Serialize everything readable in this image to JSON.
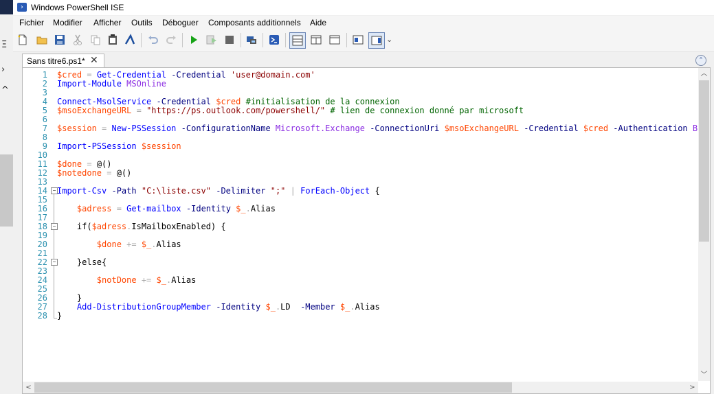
{
  "window": {
    "title": "Windows PowerShell ISE"
  },
  "menu": [
    "Fichier",
    "Modifier",
    "Afficher",
    "Outils",
    "Déboguer",
    "Composants additionnels",
    "Aide"
  ],
  "toolbar": {
    "icons": [
      "new-script-icon",
      "open-icon",
      "save-icon",
      "cut-icon",
      "copy-icon",
      "paste-icon",
      "console-prompt-icon",
      "undo-icon",
      "redo-icon",
      "run-icon",
      "run-selection-icon",
      "stop-icon",
      "remote-powershell-icon",
      "start-powershell-icon",
      "show-script-pane-top-icon",
      "show-script-pane-right-icon",
      "show-script-pane-max-icon",
      "show-command-window-icon",
      "show-command-addon-icon"
    ],
    "overflow": "⌄"
  },
  "tab": {
    "label": "Sans titre6.ps1*",
    "close": "✕"
  },
  "left_strip": {
    "glyphs": [
      "Ξ",
      "›",
      "^"
    ]
  },
  "editor": {
    "lines": [
      [
        [
          "v",
          "$cred"
        ],
        [
          "o",
          " = "
        ],
        [
          "k",
          "Get-Credential"
        ],
        [
          "n",
          " "
        ],
        [
          "p",
          "-Credential"
        ],
        [
          "n",
          " "
        ],
        [
          "s",
          "'user@domain.com'"
        ]
      ],
      [
        [
          "k",
          "Import-Module"
        ],
        [
          "n",
          " "
        ],
        [
          "t",
          "MSOnline"
        ]
      ],
      [],
      [
        [
          "k",
          "Connect-MsolService"
        ],
        [
          "n",
          " "
        ],
        [
          "p",
          "-Credential"
        ],
        [
          "n",
          " "
        ],
        [
          "v",
          "$cred"
        ],
        [
          "n",
          " "
        ],
        [
          "c",
          "#initialisation de la connexion"
        ]
      ],
      [
        [
          "v",
          "$msoExchangeURL"
        ],
        [
          "o",
          " = "
        ],
        [
          "s",
          "\"https://ps.outlook.com/powershell/\""
        ],
        [
          "n",
          " "
        ],
        [
          "c",
          "# lien de connexion donné par microsoft"
        ]
      ],
      [],
      [
        [
          "v",
          "$session"
        ],
        [
          "o",
          " = "
        ],
        [
          "k",
          "New-PSSession"
        ],
        [
          "n",
          " "
        ],
        [
          "p",
          "-ConfigurationName"
        ],
        [
          "n",
          " "
        ],
        [
          "t",
          "Microsoft.Exchange"
        ],
        [
          "n",
          " "
        ],
        [
          "p",
          "-ConnectionUri"
        ],
        [
          "n",
          " "
        ],
        [
          "v",
          "$msoExchangeURL"
        ],
        [
          "n",
          " "
        ],
        [
          "p",
          "-Credential"
        ],
        [
          "n",
          " "
        ],
        [
          "v",
          "$cred"
        ],
        [
          "n",
          " "
        ],
        [
          "p",
          "-Authentication"
        ],
        [
          "n",
          " "
        ],
        [
          "t",
          "B"
        ]
      ],
      [],
      [
        [
          "k",
          "Import-PSSession"
        ],
        [
          "n",
          " "
        ],
        [
          "v",
          "$session"
        ]
      ],
      [],
      [
        [
          "v",
          "$done"
        ],
        [
          "o",
          " = "
        ],
        [
          "n",
          "@()"
        ]
      ],
      [
        [
          "v",
          "$notedone"
        ],
        [
          "o",
          " = "
        ],
        [
          "n",
          "@()"
        ]
      ],
      [],
      [
        [
          "k",
          "Import-Csv"
        ],
        [
          "n",
          " "
        ],
        [
          "p",
          "-Path"
        ],
        [
          "n",
          " "
        ],
        [
          "s",
          "\"C:\\liste.csv\""
        ],
        [
          "n",
          " "
        ],
        [
          "p",
          "-Delimiter"
        ],
        [
          "n",
          " "
        ],
        [
          "s",
          "\";\""
        ],
        [
          "n",
          " "
        ],
        [
          "o",
          "|"
        ],
        [
          "n",
          " "
        ],
        [
          "k",
          "ForEach-Object"
        ],
        [
          "n",
          " {"
        ]
      ],
      [],
      [
        [
          "n",
          "    "
        ],
        [
          "v",
          "$adress"
        ],
        [
          "o",
          " = "
        ],
        [
          "k",
          "Get-mailbox"
        ],
        [
          "n",
          " "
        ],
        [
          "p",
          "-Identity"
        ],
        [
          "n",
          " "
        ],
        [
          "v",
          "$_"
        ],
        [
          "o",
          "."
        ],
        [
          "n",
          "Alias"
        ]
      ],
      [],
      [
        [
          "n",
          "    if("
        ],
        [
          "v",
          "$adress"
        ],
        [
          "o",
          "."
        ],
        [
          "n",
          "IsMailboxEnabled) {"
        ]
      ],
      [],
      [
        [
          "n",
          "        "
        ],
        [
          "v",
          "$done"
        ],
        [
          "o",
          " += "
        ],
        [
          "v",
          "$_"
        ],
        [
          "o",
          "."
        ],
        [
          "n",
          "Alias"
        ]
      ],
      [],
      [
        [
          "n",
          "    }else{"
        ]
      ],
      [],
      [
        [
          "n",
          "        "
        ],
        [
          "v",
          "$notDone"
        ],
        [
          "o",
          " += "
        ],
        [
          "v",
          "$_"
        ],
        [
          "o",
          "."
        ],
        [
          "n",
          "Alias"
        ]
      ],
      [],
      [
        [
          "n",
          "    }"
        ]
      ],
      [
        [
          "n",
          "    "
        ],
        [
          "k",
          "Add-DistributionGroupMember"
        ],
        [
          "n",
          " "
        ],
        [
          "p",
          "-Identity"
        ],
        [
          "n",
          " "
        ],
        [
          "v",
          "$_"
        ],
        [
          "o",
          "."
        ],
        [
          "n",
          "LD  "
        ],
        [
          "p",
          "-Member"
        ],
        [
          "n",
          " "
        ],
        [
          "v",
          "$_"
        ],
        [
          "o",
          "."
        ],
        [
          "n",
          "Alias"
        ]
      ],
      [
        [
          "n",
          "}"
        ]
      ]
    ]
  },
  "colors": {
    "variable": "#ff4500",
    "command": "#0000ff",
    "string": "#8b0000",
    "comment": "#006400",
    "parameter": "#000080",
    "type": "#8a2be2",
    "operator": "#a9a9a9",
    "line_number": "#2b91af"
  }
}
